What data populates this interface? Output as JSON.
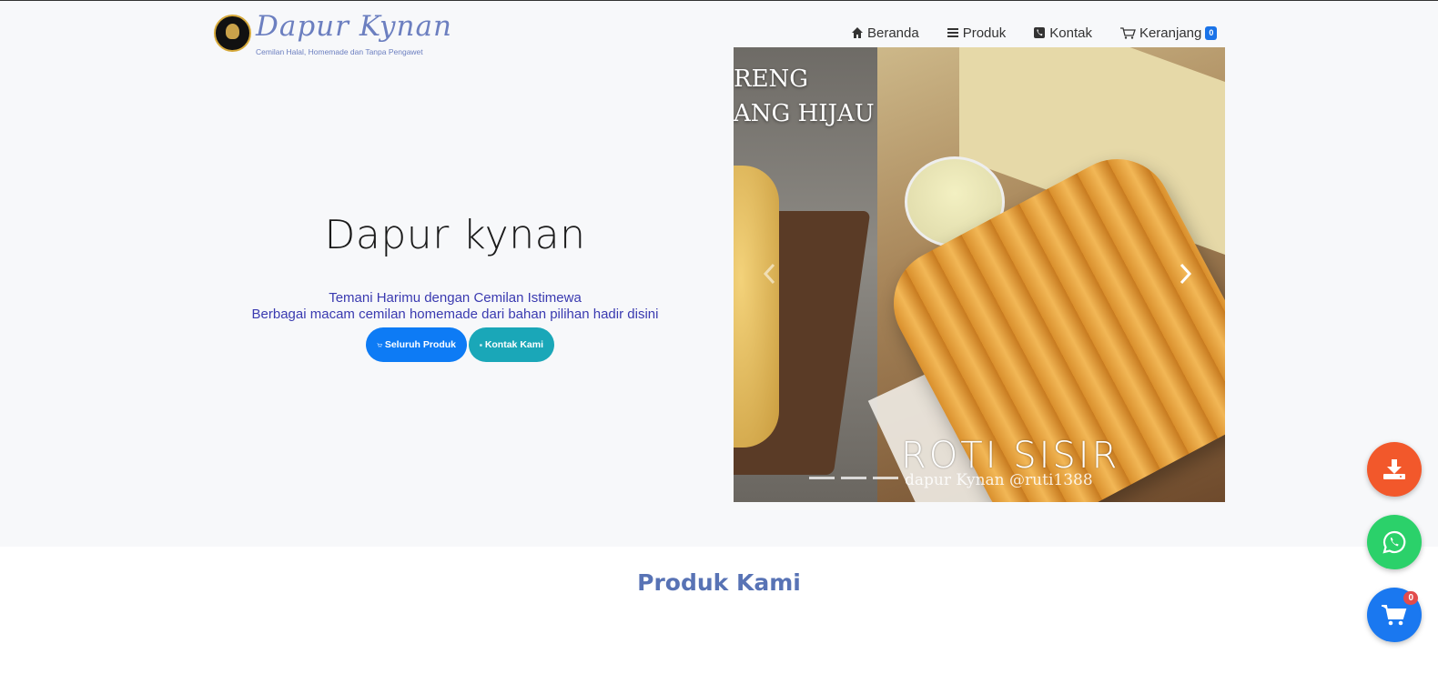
{
  "brand": {
    "name": "Dapur Kynan",
    "tagline": "Cemilan Halal, Homemade dan Tanpa Pengawet"
  },
  "nav": {
    "home": "Beranda",
    "products": "Produk",
    "contact": "Kontak",
    "cart": "Keranjang",
    "cart_count": "0"
  },
  "hero": {
    "title": "Dapur kynan",
    "subtitle_line1": "Temani Harimu dengan Cemilan Istimewa",
    "subtitle_line2": "Berbagai macam cemilan homemade dari bahan pilihan hadir disini",
    "btn_products": "Seluruh Produk",
    "btn_contact": "Kontak Kami"
  },
  "carousel": {
    "left_text_line1": "RENG",
    "left_text_line2": "ANG HIJAU",
    "caption": "ROTI  SISIR",
    "credit": "dapur Kynan @ruti1388",
    "indicator_count": 3,
    "active_index": 3
  },
  "section": {
    "title": "Produk Kami"
  },
  "floating": {
    "cart_count": "0"
  },
  "colors": {
    "primary": "#0d7bf5",
    "teal": "#1aa7b8",
    "brand_blue": "#6c7fc0",
    "download": "#f2582b",
    "whatsapp": "#2bd16a"
  }
}
